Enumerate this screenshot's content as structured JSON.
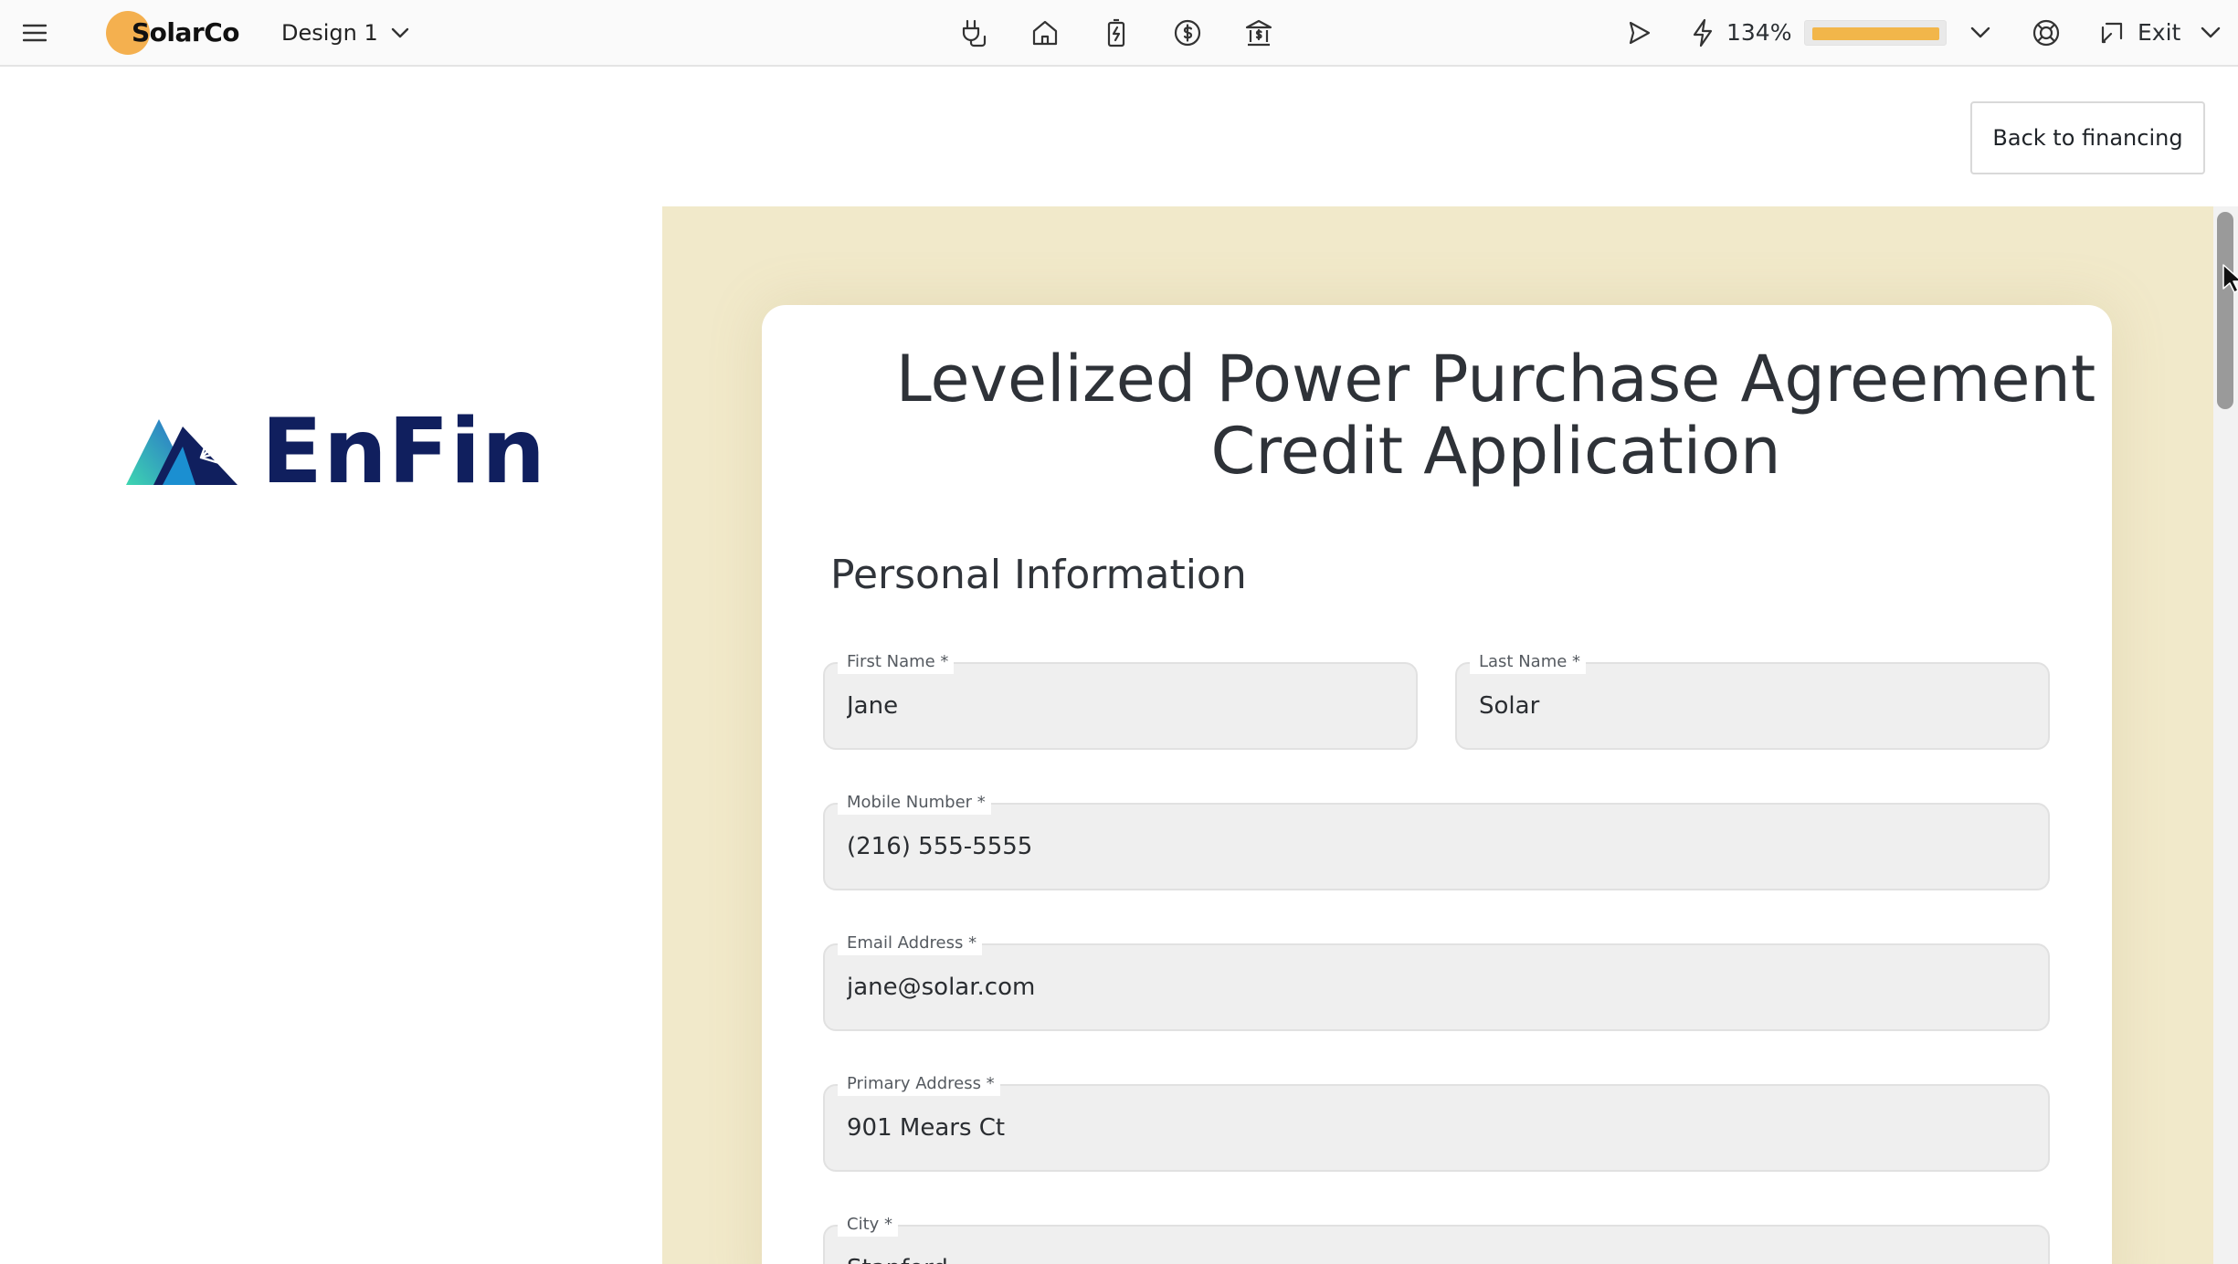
{
  "topbar": {
    "brand": "SolarCo",
    "design_label": "Design 1",
    "nav_icons": [
      "plug-icon",
      "home-icon",
      "battery-icon",
      "dollar-circle-icon",
      "bank-icon"
    ],
    "zoom_text": "134%",
    "zoom_progress": 0.94,
    "exit_label": "Exit",
    "colors": {
      "brand_dot": "#f4b04f",
      "zoom_fill": "#f2b64a"
    }
  },
  "back_button": "Back to financing",
  "logo": {
    "text": "EnFin",
    "color": "#101f5e"
  },
  "form": {
    "title_line1": "Levelized Power Purchase Agreement",
    "title_line2": "Credit Application",
    "section_title": "Personal Information",
    "frame_color": "#f1e9ca",
    "fields": {
      "first_name": {
        "label": "First Name *",
        "value": "Jane"
      },
      "last_name": {
        "label": "Last Name *",
        "value": "Solar"
      },
      "mobile": {
        "label": "Mobile Number *",
        "value": "(216) 555-5555"
      },
      "email": {
        "label": "Email Address *",
        "value": "jane@solar.com"
      },
      "address": {
        "label": "Primary Address *",
        "value": "901 Mears Ct"
      },
      "city": {
        "label": "City *",
        "value": "Stanford"
      }
    }
  }
}
